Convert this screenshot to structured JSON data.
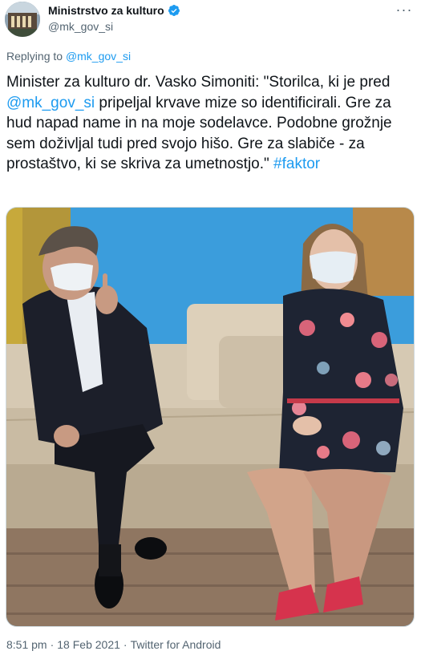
{
  "author": {
    "display_name": "Ministrstvo za kulturo",
    "handle": "@mk_gov_si",
    "verified": true
  },
  "more_icon": "more-horizontal-icon",
  "replying": {
    "prefix": "Replying to ",
    "handle": "@mk_gov_si"
  },
  "tweet": {
    "text_part1": "Minister za kulturo dr. Vasko Simoniti: \"Storilca, ki je pred ",
    "mention": "@mk_gov_si",
    "text_part2": " pripeljal krvave mize so identificirali. Gre za hud napad name in na moje sodelavce. Podobne grožnje sem doživljal tudi pred svojo hišo. Gre za slabiče - za prostaštvo, ki se skriva za umetnostjo.\" ",
    "hashtag": "#faktor"
  },
  "meta": {
    "time": "8:51 pm",
    "sep1": "·",
    "date": "18 Feb 2021",
    "sep2": "·",
    "source": "Twitter for Android"
  },
  "colors": {
    "link": "#1d9bf0",
    "secondary_text": "#536471",
    "wall_blue": "#3b9ddc",
    "sofa": "#cdbfa8",
    "floor": "#8f7661"
  }
}
